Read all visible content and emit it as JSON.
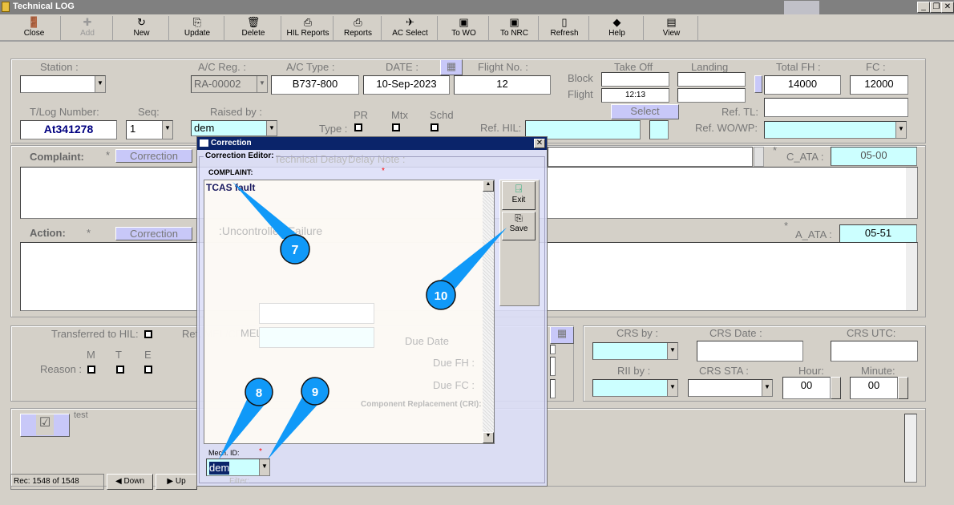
{
  "window": {
    "title": "Technical LOG"
  },
  "toolbar": [
    {
      "label": "Close",
      "icon": "door-exit-icon"
    },
    {
      "label": "Add",
      "icon": "add-icon",
      "disabled": true
    },
    {
      "label": "New",
      "icon": "new-icon"
    },
    {
      "label": "Update",
      "icon": "update-icon"
    },
    {
      "label": "Delete",
      "icon": "trash-icon"
    },
    {
      "label": "HIL Reports",
      "icon": "printer-icon"
    },
    {
      "label": "Reports",
      "icon": "printer-icon"
    },
    {
      "label": "AC Select",
      "icon": "airplane-icon"
    },
    {
      "label": "To WO",
      "icon": "to-wo-icon"
    },
    {
      "label": "To NRC",
      "icon": "to-nrc-icon"
    },
    {
      "label": "Refresh",
      "icon": "refresh-icon"
    },
    {
      "label": "Help",
      "icon": "help-icon"
    },
    {
      "label": "View",
      "icon": "view-icon"
    }
  ],
  "header": {
    "station_label": "Station :",
    "station": "",
    "acreg_label": "A/C Reg. :",
    "acreg": "RA-00002",
    "actype_label": "A/C Type :",
    "actype": "B737-800",
    "date_label": "DATE :",
    "date": "10-Sep-2023",
    "flight_label": "Flight No. :",
    "flight": "12",
    "block_label": "Block",
    "flight2_label": "Flight",
    "flight_time": "12:13",
    "takeoff_label": "Take Off",
    "landing_label": "Landing",
    "totalfh_label": "Total FH :",
    "totalfh": "14000",
    "fc_label": "FC :",
    "fc": "12000",
    "tlog_label": "T/Log Number:",
    "tlog": "At341278",
    "seq_label": "Seq:",
    "seq": "1",
    "raised_label": "Raised by :",
    "raised": "dem",
    "type_label": "Type :",
    "pr_label": "PR",
    "mtx_label": "Mtx",
    "schd_label": "Schd",
    "select_label": "Select",
    "reftl_label": "Ref. TL:",
    "refhil_label": "Ref. HIL:",
    "refwo_label": "Ref. WO/WP:",
    "star": "*"
  },
  "complaint": {
    "label": "Complaint:",
    "correction": "Correction",
    "cata_label": "C_ATA :",
    "cata": "05-00",
    "delay_label": "Technical Delay :",
    "delaynote_label": "Delay Note :"
  },
  "action": {
    "label": "Action:",
    "correction": "Correction",
    "uncontrolled": ":Uncontrolled Failure",
    "aata_label": "A_ATA :",
    "aata": "05-51"
  },
  "hil": {
    "transferred": "Transferred to HIL:",
    "reason": "Reason :",
    "m": "M",
    "t": "T",
    "e": "E",
    "refmel": "Ref. MEL/CDL:",
    "melcat": "MEL Cat:",
    "duedate": "Due Date",
    "duefh": "Due FH :",
    "duefc": "Due FC :"
  },
  "crs": {
    "crsby": "CRS by :",
    "crsdate": "CRS Date :",
    "crsutc": "CRS UTC:",
    "riiby": "RII by :",
    "crssta": "CRS STA :",
    "hour_label": "Hour:",
    "hour": "00",
    "minute_label": "Minute:",
    "minute": "00"
  },
  "bottom": {
    "test": "test",
    "component": "Component Replacement (CRI):",
    "filter": "Filter:"
  },
  "status": {
    "rec": "Rec: 1548 of 1548",
    "down": "Down",
    "up": "Up"
  },
  "dialog": {
    "title": "Correction",
    "group": "Correction Editor:",
    "complaint_label": "COMPLAINT:",
    "star": "*",
    "text": "TCAS fault",
    "exit": "Exit",
    "save": "Save",
    "mech_label": "Mech. ID:",
    "mech": "dem"
  },
  "callouts": [
    "7",
    "8",
    "9",
    "10"
  ]
}
